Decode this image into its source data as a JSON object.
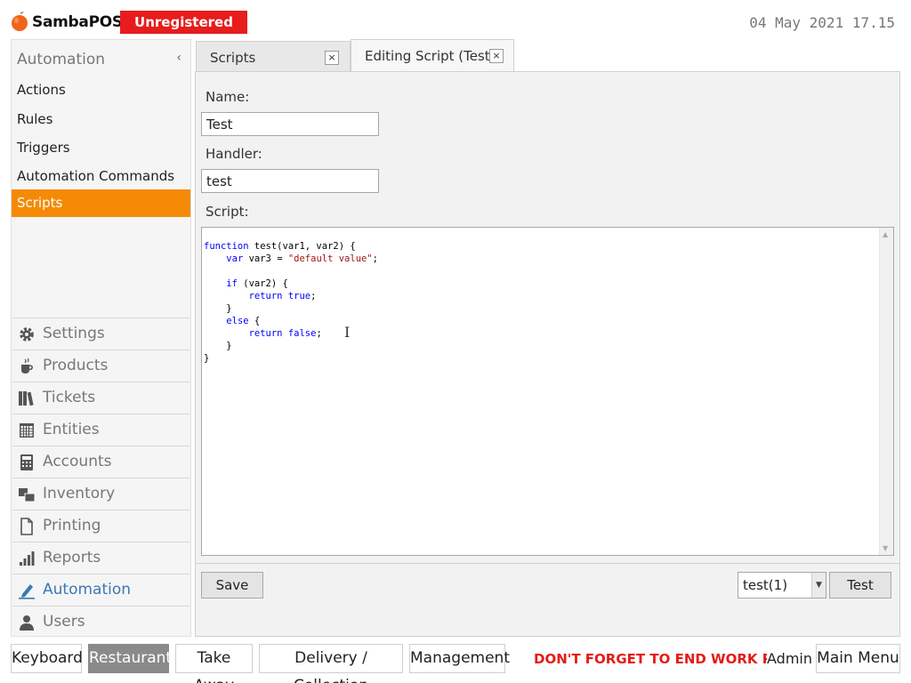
{
  "header": {
    "brand": "SambaPOS",
    "trial_badge": "Unregistered Trial",
    "datetime": "04 May 2021 17.15",
    "logo_icon": "apple-logo-icon"
  },
  "sidebar": {
    "title": "Automation",
    "collapse_glyph": "‹",
    "items": [
      {
        "label": "Actions",
        "active": false
      },
      {
        "label": "Rules",
        "active": false
      },
      {
        "label": "Triggers",
        "active": false
      },
      {
        "label": "Automation Commands",
        "active": false
      },
      {
        "label": "Scripts",
        "active": true
      }
    ],
    "modules": [
      {
        "label": "Settings",
        "icon": "gear-icon"
      },
      {
        "label": "Products",
        "icon": "coffee-cup-icon"
      },
      {
        "label": "Tickets",
        "icon": "books-icon"
      },
      {
        "label": "Entities",
        "icon": "table-grid-icon"
      },
      {
        "label": "Accounts",
        "icon": "calculator-icon"
      },
      {
        "label": "Inventory",
        "icon": "boxes-icon"
      },
      {
        "label": "Printing",
        "icon": "document-icon"
      },
      {
        "label": "Reports",
        "icon": "bar-chart-icon"
      },
      {
        "label": "Automation",
        "icon": "pencil-icon",
        "active": true
      },
      {
        "label": "Users",
        "icon": "user-icon"
      }
    ]
  },
  "tabs": [
    {
      "label": "Scripts",
      "close": "×"
    },
    {
      "label": "Editing Script (Test)",
      "close": "×"
    }
  ],
  "form": {
    "name_label": "Name:",
    "name_value": "Test",
    "handler_label": "Handler:",
    "handler_value": "test",
    "script_label": "Script:"
  },
  "script": {
    "language": "javascript",
    "code": "function test(var1, var2) {\n    var var3 = \"default value\";\n\n    if (var2) {\n        return true;\n    }\n    else {\n        return false;\n    }\n}"
  },
  "actions": {
    "save_label": "Save",
    "test_select_value": "test(1)",
    "test_label": "Test"
  },
  "bottom_bar": {
    "buttons": [
      {
        "label": "Keyboard",
        "active": false
      },
      {
        "label": "Restaurant",
        "active": true
      },
      {
        "label": "Take Away",
        "active": false
      },
      {
        "label": "Delivery / Collection",
        "active": false
      },
      {
        "label": "Management",
        "active": false
      }
    ],
    "marquee": "DON'T FORGET TO END WORK PERIOD",
    "user": "Admin",
    "main_menu_label": "Main Menu"
  },
  "colors": {
    "accent_orange": "#f58a07",
    "trial_red": "#e81c1c",
    "automation_blue": "#3c78b5",
    "marquee_red": "#e41b17"
  }
}
